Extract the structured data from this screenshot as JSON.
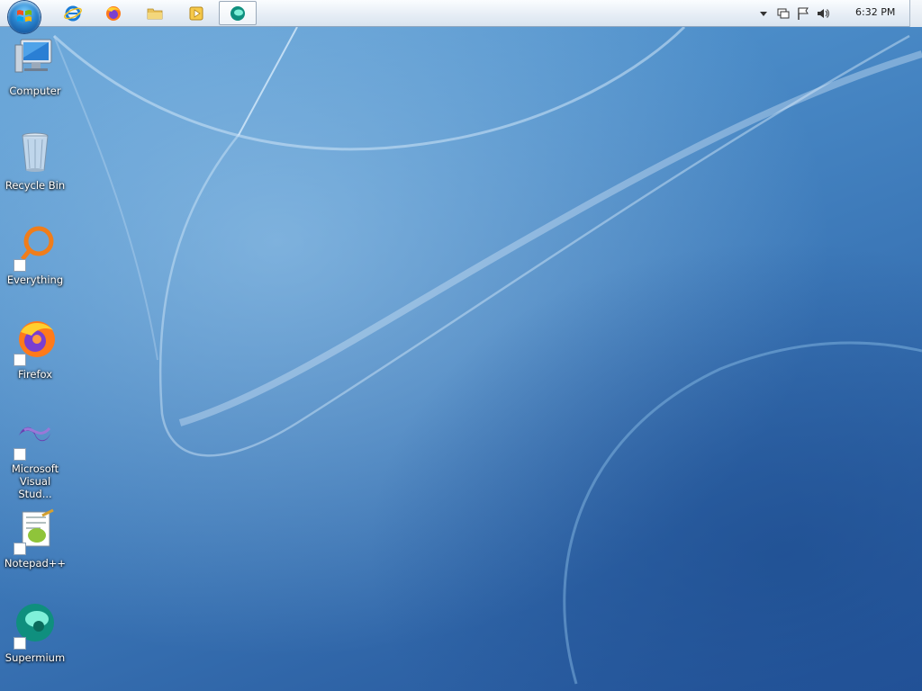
{
  "taskbar": {
    "start_button": "start-orb",
    "pinned": [
      {
        "name": "internet-explorer",
        "icon": "ie-icon"
      },
      {
        "name": "firefox",
        "icon": "firefox-icon"
      },
      {
        "name": "file-explorer",
        "icon": "folder-icon"
      },
      {
        "name": "media-player",
        "icon": "media-player-icon"
      },
      {
        "name": "supermium",
        "icon": "supermium-icon",
        "active": true
      }
    ],
    "tray": {
      "icons": [
        "chevron-up-icon",
        "network-icon",
        "action-center-flag-icon",
        "volume-icon"
      ],
      "clock": "6:32 PM"
    }
  },
  "desktop": {
    "icons": [
      {
        "id": "computer",
        "label": "Computer",
        "icon": "computer-icon",
        "shortcut": false
      },
      {
        "id": "recycle-bin",
        "label": "Recycle Bin",
        "icon": "recycle-bin-icon",
        "shortcut": false
      },
      {
        "id": "everything",
        "label": "Everything",
        "icon": "everything-icon",
        "shortcut": true
      },
      {
        "id": "firefox",
        "label": "Firefox",
        "icon": "firefox-icon",
        "shortcut": true
      },
      {
        "id": "visual-studio",
        "label": "Microsoft Visual Stud...",
        "icon": "visual-studio-icon",
        "shortcut": true
      },
      {
        "id": "notepadpp",
        "label": "Notepad++",
        "icon": "notepadpp-icon",
        "shortcut": true
      },
      {
        "id": "supermium",
        "label": "Supermium",
        "icon": "supermium-icon",
        "shortcut": true
      }
    ]
  },
  "colors": {
    "wallpaper_top": "#5fa0d6",
    "wallpaper_bottom": "#23539a",
    "taskbar_bg": "#e7eef6",
    "icon_label": "#ffffff"
  }
}
